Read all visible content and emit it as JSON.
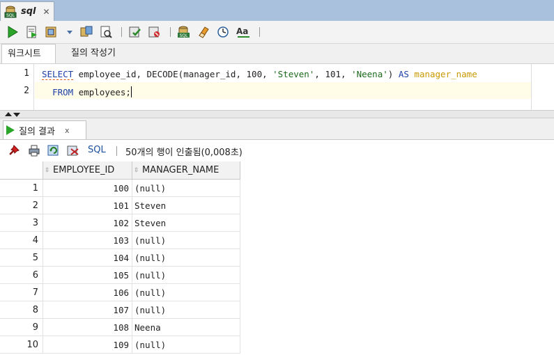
{
  "tab": {
    "label": "sql",
    "close": "✕"
  },
  "subtabs": [
    {
      "label": "워크시트"
    },
    {
      "label": "질의 작성기"
    }
  ],
  "editor": {
    "line_numbers": [
      "1",
      "2"
    ],
    "line1": {
      "select": "SELECT",
      "part1": " employee_id, DECODE(manager_id, ",
      "n100": "100",
      "comma1": ", ",
      "s_steven": "'Steven'",
      "comma2": ", ",
      "n101": "101",
      "comma3": ", ",
      "s_neena": "'Neena'",
      "close": ") ",
      "as": "AS",
      "space": " ",
      "alias": "manager_name"
    },
    "line2": {
      "indent": "  ",
      "from": "FROM",
      "rest": " employees;"
    }
  },
  "results": {
    "tab_label": "질의 결과",
    "tab_close": "x",
    "sql_link": "SQL",
    "status": "50개의 행이 인출됨(0,008초)",
    "columns": [
      "EMPLOYEE_ID",
      "MANAGER_NAME"
    ],
    "rows": [
      {
        "n": "1",
        "emp": "100",
        "mgr": "(null)"
      },
      {
        "n": "2",
        "emp": "101",
        "mgr": "Steven"
      },
      {
        "n": "3",
        "emp": "102",
        "mgr": "Steven"
      },
      {
        "n": "4",
        "emp": "103",
        "mgr": "(null)"
      },
      {
        "n": "5",
        "emp": "104",
        "mgr": "(null)"
      },
      {
        "n": "6",
        "emp": "105",
        "mgr": "(null)"
      },
      {
        "n": "7",
        "emp": "106",
        "mgr": "(null)"
      },
      {
        "n": "8",
        "emp": "107",
        "mgr": "(null)"
      },
      {
        "n": "9",
        "emp": "108",
        "mgr": "Neena"
      },
      {
        "n": "10",
        "emp": "109",
        "mgr": "(null)"
      }
    ]
  },
  "colors": {
    "keyword": "#1c3fa8",
    "string": "#1c6a1c",
    "alias": "#c89a00",
    "run_green": "#2aa52a",
    "tabstrip": "#a9c1dc"
  },
  "icons": {
    "tab": "sql-worksheet-icon",
    "toolbar": [
      "run-statement-icon",
      "run-script-icon",
      "autotrace-icon",
      "dropdown-arrow-icon",
      "explain-plan-icon",
      "sql-tuning-icon",
      "commit-icon",
      "rollback-icon",
      "unshared-sql-icon",
      "eraser-icon",
      "history-icon",
      "format-icon"
    ],
    "results_toolbar": [
      "pin-icon",
      "print-icon",
      "refresh-icon",
      "export-icon"
    ]
  }
}
